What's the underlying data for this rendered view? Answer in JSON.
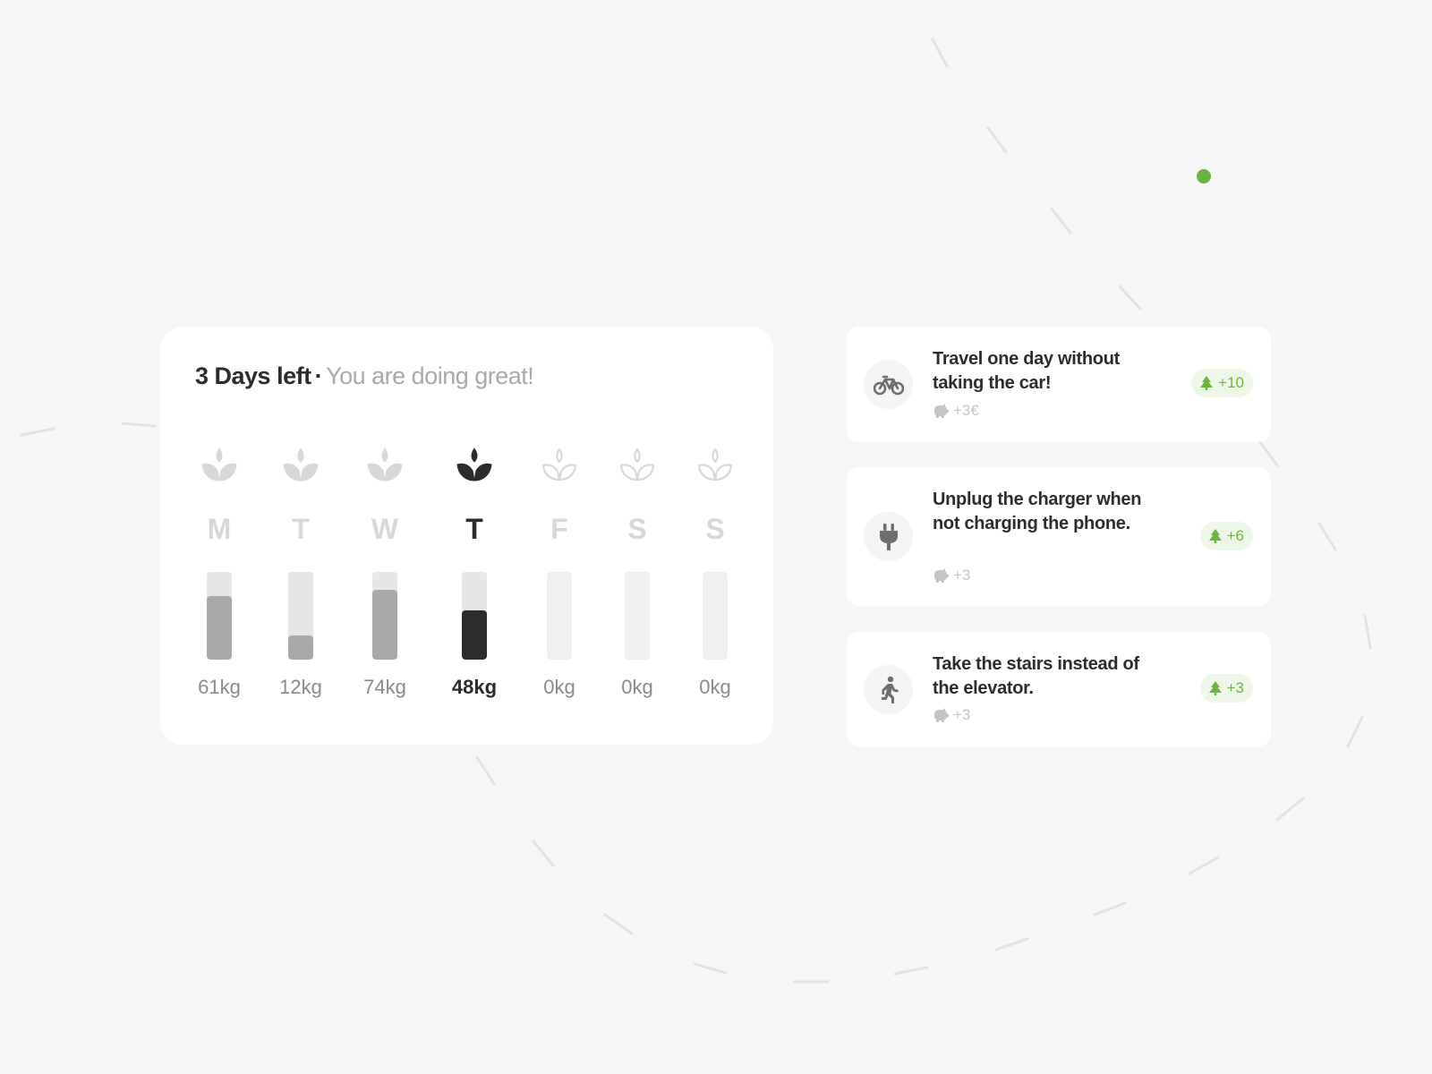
{
  "summary": {
    "days_left": "3 Days left",
    "separator": "·",
    "message": "You are doing great!"
  },
  "week": [
    {
      "day": "M",
      "value_label": "61kg",
      "level": 0.72,
      "state": "past"
    },
    {
      "day": "T",
      "value_label": "12kg",
      "level": 0.28,
      "state": "past"
    },
    {
      "day": "W",
      "value_label": "74kg",
      "level": 0.8,
      "state": "past"
    },
    {
      "day": "T",
      "value_label": "48kg",
      "level": 0.56,
      "state": "current"
    },
    {
      "day": "F",
      "value_label": "0kg",
      "level": 0,
      "state": "future"
    },
    {
      "day": "S",
      "value_label": "0kg",
      "level": 0,
      "state": "future"
    },
    {
      "day": "S",
      "value_label": "0kg",
      "level": 0,
      "state": "future"
    }
  ],
  "tasks": [
    {
      "icon": "bicycle-icon",
      "title": "Travel one day without taking the car!",
      "reward": "+3€",
      "points": "+10"
    },
    {
      "icon": "plug-icon",
      "title": "Unplug the charger when not charging the phone.",
      "reward": "+3",
      "points": "+6"
    },
    {
      "icon": "stairs-runner-icon",
      "title": "Take the stairs instead of the elevator.",
      "reward": "+3",
      "points": "+3"
    }
  ],
  "colors": {
    "background": "#f6f6f6",
    "card": "#ffffff",
    "ink": "#2c2c2e",
    "muted": "#a9a9a9",
    "accent_green": "#6bb43f",
    "badge_bg": "#eef6e8"
  }
}
